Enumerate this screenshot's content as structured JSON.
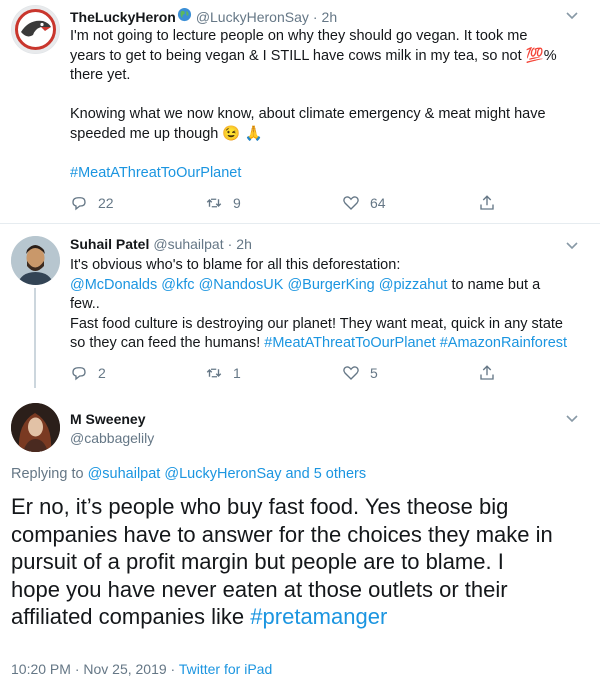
{
  "tweet1": {
    "name": "TheLuckyHeron",
    "handle": "@LuckyHeronSay",
    "dot": "·",
    "time": "2h",
    "line1": "I'm not going to lecture people on why they should go vegan. It took me",
    "line2a": "years to get to being vegan & I STILL have cows milk in my tea, so not ",
    "emoji100": "💯",
    "line2b": "%",
    "line3": "there yet.",
    "line4": "Knowing what we now know, about climate emergency & meat might have",
    "line5": "speeded me up though ",
    "emoji_wink": "😉",
    "emoji_pray": "🙏",
    "hashtag": "#MeatAThreatToOurPlanet",
    "replies": "22",
    "retweets": "9",
    "likes": "64"
  },
  "tweet2": {
    "name": "Suhail Patel",
    "handle": "@suhailpat",
    "dot": "·",
    "time": "2h",
    "line1": "It's obvious who's to blame for all this deforestation:",
    "mentions": [
      "@McDonalds",
      "@kfc",
      "@NandosUK",
      "@BurgerKing",
      "@pizzahut"
    ],
    "tail2": "to name but a",
    "line3": "few..",
    "line4": "Fast food culture is destroying our planet! They want meat, quick in any state",
    "line5": "so they can feed the humans! ",
    "hashtag1": "#MeatAThreatToOurPlanet",
    "hashtag2": "#AmazonRainforest",
    "replies": "2",
    "retweets": "1",
    "likes": "5"
  },
  "tweet3": {
    "name": "M Sweeney",
    "handle": "@cabbagelily",
    "replying_prefix": "Replying to ",
    "replying_users": "@suhailpat @LuckyHeronSay",
    "replying_suffix": " and 5 others",
    "line1": "Er no, it’s people who buy fast food.  Yes theose big",
    "line2": "companies have to answer for the choices they make in",
    "line3": "pursuit of a profit margin but people are to blame.  I",
    "line4": "hope you have never eaten at those outlets or their",
    "line5": "affiliated companies like ",
    "hashtag": "#pretamanger",
    "timestamp": "10:20 PM · Nov 25, 2019",
    "sep": " · ",
    "source": "Twitter for iPad"
  },
  "icons": {
    "caret": "chevron-down-icon",
    "reply": "reply-icon",
    "retweet": "retweet-icon",
    "like": "heart-icon",
    "share": "share-icon",
    "globe": "globe-icon"
  },
  "colors": {
    "link": "#1b95e0",
    "muted": "#657786",
    "text": "#14171a",
    "border": "#e6ecf0"
  }
}
